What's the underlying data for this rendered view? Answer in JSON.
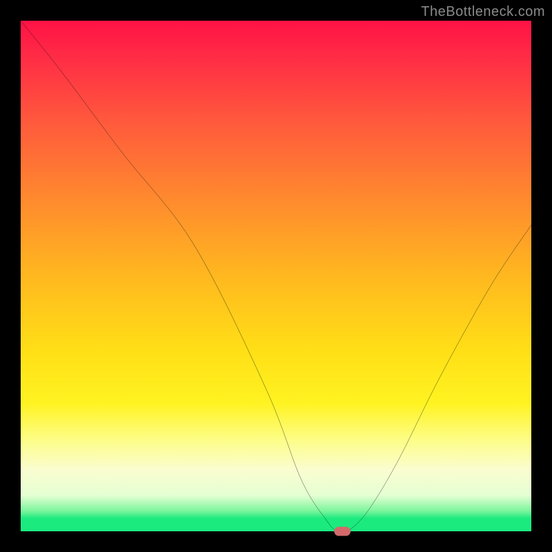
{
  "watermark": "TheBottleneck.com",
  "chart_data": {
    "type": "line",
    "title": "",
    "xlabel": "",
    "ylabel": "",
    "xlim": [
      0,
      100
    ],
    "ylim": [
      0,
      100
    ],
    "grid": false,
    "legend": false,
    "series": [
      {
        "name": "bottleneck-curve",
        "x": [
          0,
          8,
          20,
          34,
          48,
          55,
          60,
          62,
          64,
          68,
          74,
          82,
          92,
          100
        ],
        "y": [
          100,
          90,
          74,
          56,
          28,
          10,
          2,
          0,
          0,
          4,
          14,
          30,
          48,
          60
        ]
      }
    ],
    "marker": {
      "name": "optimal-point",
      "x": 63,
      "y": 0,
      "color": "#d36a6a"
    },
    "background_gradient": {
      "top": "#ff1245",
      "mid": "#ffd51a",
      "bottom": "#1bea7f"
    }
  }
}
